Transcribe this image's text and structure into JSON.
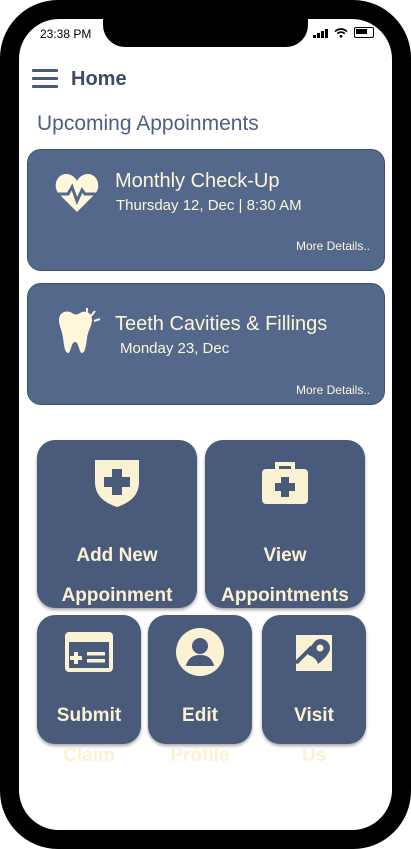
{
  "status_bar": {
    "time": "23:38 PM"
  },
  "header": {
    "title": "Home"
  },
  "upcoming": {
    "title": "Upcoming Appoinments",
    "appointments": [
      {
        "title": "Monthly Check-Up",
        "date": "Thursday 12, Dec | 8:30 AM",
        "more": "More Details..",
        "icon": "heart-pulse-icon"
      },
      {
        "title": "Teeth Cavities & Fillings",
        "date": "Monday 23, Dec",
        "more": "More Details..",
        "icon": "tooth-icon"
      }
    ]
  },
  "actions": {
    "add_appointment": {
      "line1": "Add New",
      "line2": "Appoinment",
      "icon": "shield-plus-icon"
    },
    "view_appointments": {
      "line1": "View",
      "line2": "Appointments",
      "icon": "medical-kit-icon"
    },
    "submit_claim": {
      "line1": "Submit",
      "line2": "Claim",
      "icon": "claim-card-icon"
    },
    "edit_profile": {
      "line1": "Edit",
      "line2": "Profile",
      "icon": "user-avatar-icon"
    },
    "visit_us": {
      "line1": "Visit",
      "line2": "Us",
      "icon": "map-pin-icon"
    }
  },
  "colors": {
    "card": "#53688b",
    "tile": "#4a5a7a",
    "text_light": "#fbf2d4",
    "heading": "#3e4b66"
  }
}
